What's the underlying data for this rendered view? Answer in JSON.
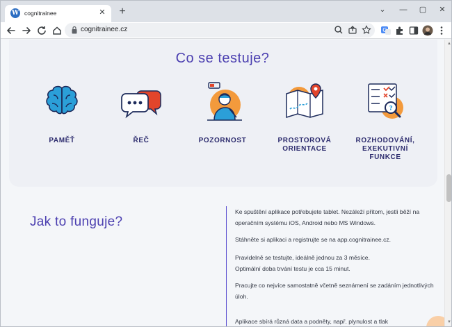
{
  "browser": {
    "tab": {
      "title": "cognitrainee",
      "favicon": "wordpress-icon"
    },
    "new_tab_symbol": "+",
    "address": {
      "url": "cognitrainee.cz"
    },
    "controls": {
      "dropdown": "⌄",
      "minimize": "—",
      "maximize": "▢",
      "close": "✕"
    }
  },
  "page": {
    "section_title": "Co se testuje?",
    "features": [
      {
        "label": "PAMĚŤ",
        "icon": "brain-icon"
      },
      {
        "label": "ŘEČ",
        "icon": "speech-bubbles-icon"
      },
      {
        "label": "POZORNOST",
        "icon": "focused-person-icon"
      },
      {
        "label": "PROSTOROVÁ\nORIENTACE",
        "icon": "map-pin-icon"
      },
      {
        "label": "ROZHODOVÁNÍ,\nEXEKUTIVNÍ\nFUNKCE",
        "icon": "checklist-magnifier-icon"
      }
    ],
    "howto_title": "Jak to funguje?",
    "howto_paragraphs": [
      "Ke spuštění aplikace potřebujete tablet. Nezáleží přitom, jestli běží na operačním systému iOS, Android nebo MS Windows.",
      "Stáhněte si aplikaci a registrujte se na app.cognitrainee.cz.",
      "Pravidelně se testujte, ideálně jednou za 3 měsíce.\nOptimální doba trvání testu je cca 15 minut.",
      "Pracujte co nejvíce samostatně včetně seznámení se zadáním jednotlivých úloh.",
      "Aplikace sbírá různá data a podněty, např. plynulost a tlak"
    ]
  },
  "colors": {
    "accent": "#4b3fb0",
    "label": "#2d2c6e",
    "orange": "#f39a3c",
    "blue": "#2b9fd8"
  }
}
